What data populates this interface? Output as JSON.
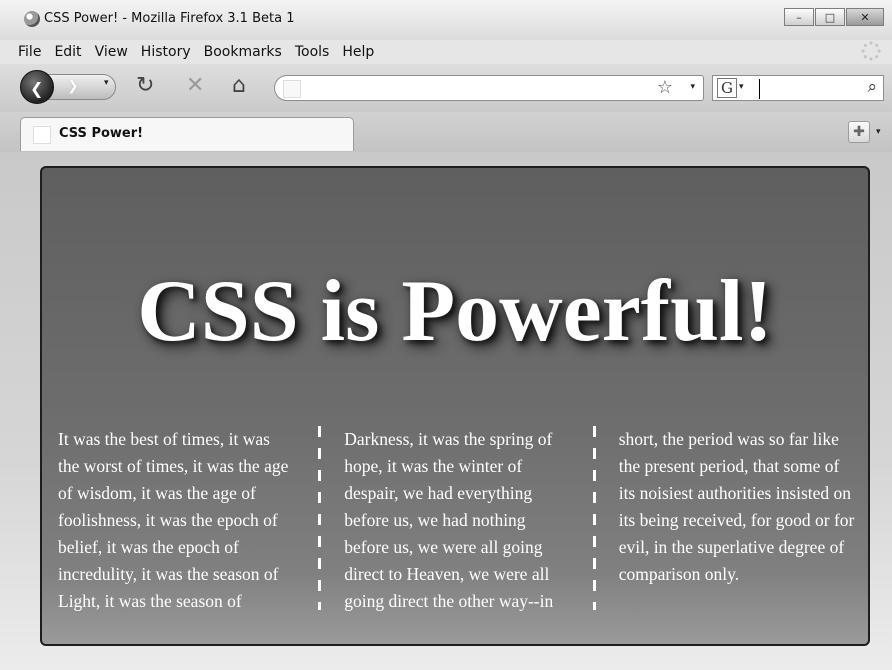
{
  "window": {
    "title": "CSS Power! - Mozilla Firefox 3.1 Beta 1"
  },
  "menu": [
    "File",
    "Edit",
    "View",
    "History",
    "Bookmarks",
    "Tools",
    "Help"
  ],
  "toolbar": {
    "url_value": "",
    "search_value": ""
  },
  "tab": {
    "title": "CSS Power!"
  },
  "page": {
    "headline": "CSS is Powerful!",
    "columns": [
      "It was the best of times, it was the worst of times, it was the age of wisdom, it was the age of foolishness, it was the epoch of belief, it was the epoch of incredulity, it was the season of Light, it was the season of",
      "Darkness, it was the spring of hope, it was the winter of despair, we had everything before us, we had nothing before us, we were all going direct to Heaven, we were all going direct the other way--in",
      "short, the period was so far like the present period, that some of its noisiest authorities insisted on its being received, for good or for evil, in the superlative degree of comparison only."
    ]
  }
}
